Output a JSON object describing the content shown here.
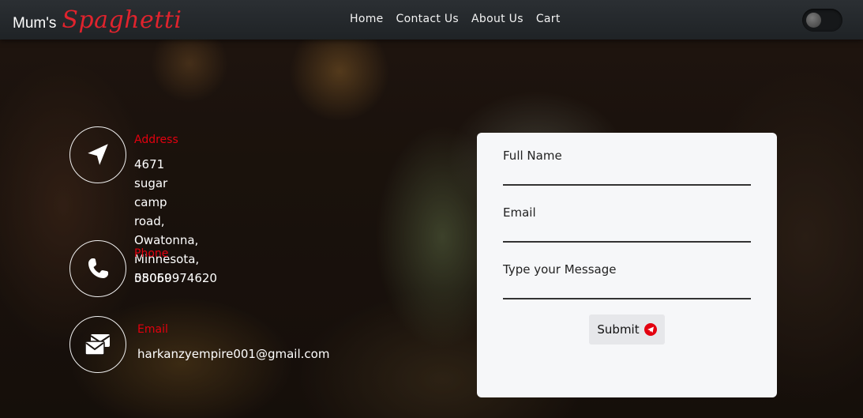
{
  "brand": {
    "main": "Mum's",
    "script": "Spaghetti"
  },
  "nav": {
    "items": [
      {
        "label": "Home"
      },
      {
        "label": "Contact Us"
      },
      {
        "label": "About Us"
      },
      {
        "label": "Cart"
      }
    ]
  },
  "theme_toggle": {
    "state": "off"
  },
  "contact": {
    "address": {
      "title": "Address",
      "lines": [
        "4671 sugar camp road,",
        "Owatonna, Minnesota,",
        "55060"
      ],
      "icon": "location-arrow-icon"
    },
    "phone": {
      "title": "Phone",
      "value": "08059974620",
      "icon": "phone-icon"
    },
    "email": {
      "title": "Email",
      "value": "harkanzyempire001@gmail.com",
      "icon": "envelopes-icon"
    }
  },
  "form": {
    "full_name_label": "Full Name",
    "full_name_value": "",
    "email_label": "Email",
    "email_value": "",
    "message_label": "Type your Message",
    "message_value": "",
    "submit_label": "Submit",
    "submit_icon": "telegram-send-icon"
  },
  "colors": {
    "accent": "#e3000f",
    "navbar": "#25292c",
    "card": "#f6f7f9"
  }
}
